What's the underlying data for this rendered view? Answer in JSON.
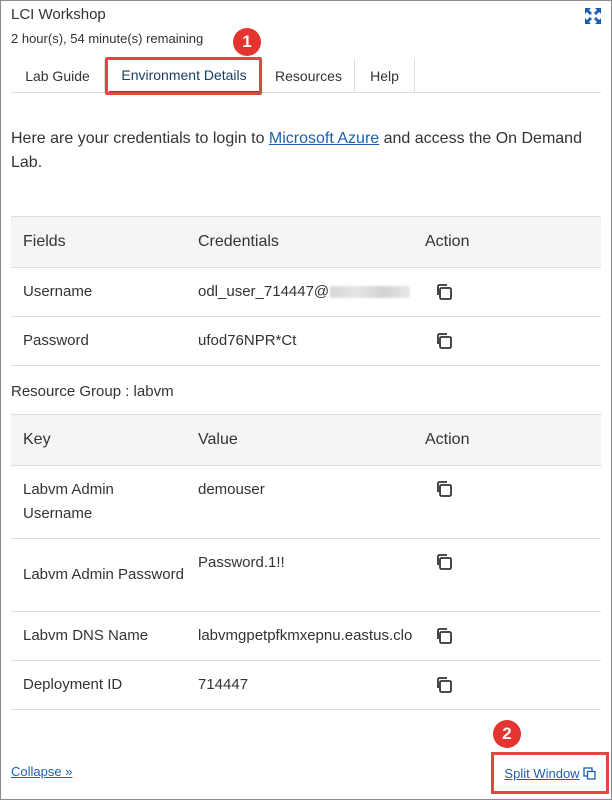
{
  "header": {
    "title": "LCI Workshop",
    "time_remaining": "2 hour(s), 54 minute(s) remaining"
  },
  "tabs": [
    {
      "label": "Lab Guide",
      "active": false
    },
    {
      "label": "Environment Details",
      "active": true
    },
    {
      "label": "Resources",
      "active": false
    },
    {
      "label": "Help",
      "active": false
    }
  ],
  "callouts": {
    "tab": "1",
    "split": "2"
  },
  "intro": {
    "before": "Here are your credentials to login to ",
    "link": "Microsoft Azure",
    "after": " and access the On Demand Lab."
  },
  "credentials_table": {
    "headers": [
      "Fields",
      "Credentials",
      "Action"
    ],
    "rows": [
      {
        "field": "Username",
        "value": "odl_user_714447@"
      },
      {
        "field": "Password",
        "value": "ufod76NPR*Ct"
      }
    ]
  },
  "resource_group": {
    "heading": "Resource Group : labvm",
    "headers": [
      "Key",
      "Value",
      "Action"
    ],
    "rows": [
      {
        "key": "Labvm Admin Username",
        "value": "demouser"
      },
      {
        "key": "Labvm Admin Password",
        "value": "Password.1!!"
      },
      {
        "key": "Labvm DNS Name",
        "value": "labvmgpetpfkmxepnu.eastus.cloudapp.azure.com"
      },
      {
        "key": "Deployment ID",
        "value": "714447"
      }
    ]
  },
  "footer": {
    "collapse": "Collapse »",
    "split_window": "Split Window"
  },
  "colors": {
    "accent": "#1a5fb4",
    "highlight": "#e34444",
    "badge": "#e3342f"
  }
}
